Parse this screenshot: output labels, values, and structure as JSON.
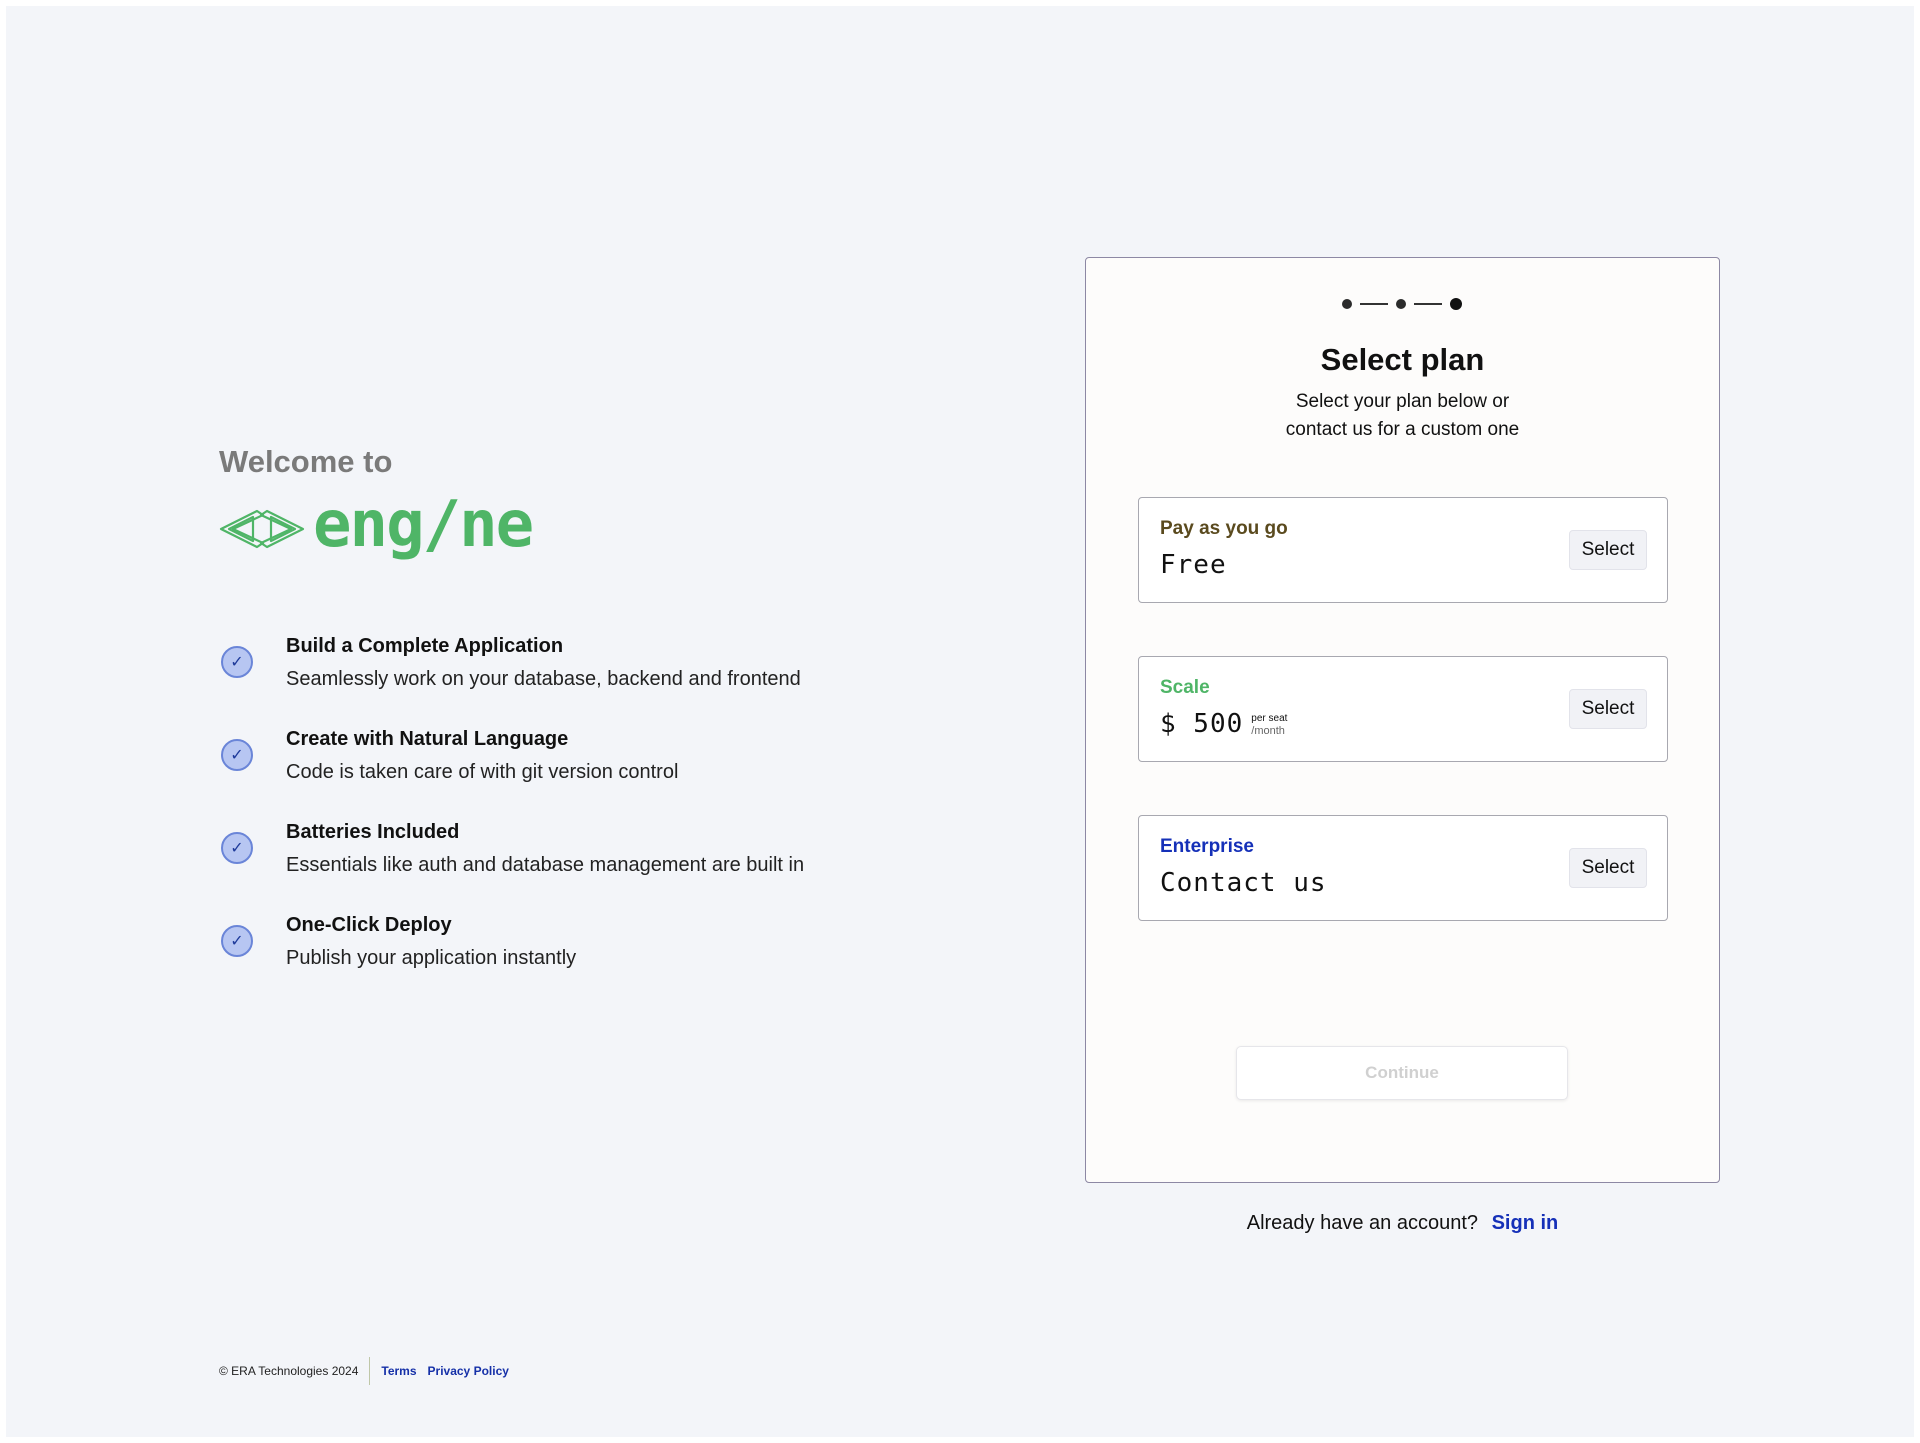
{
  "welcome": {
    "heading": "Welcome to",
    "logo_text": "eng/ne",
    "logo_icon": "code-brackets-icon"
  },
  "features": [
    {
      "title": "Build a Complete Application",
      "desc": "Seamlessly work on your database, backend and frontend"
    },
    {
      "title": "Create with Natural Language",
      "desc": "Code is taken care of with git version control"
    },
    {
      "title": "Batteries Included",
      "desc": "Essentials like auth and database management are built in"
    },
    {
      "title": "One-Click Deploy",
      "desc": "Publish your application instantly"
    }
  ],
  "footer": {
    "copyright": "© ERA Technologies 2024",
    "terms": "Terms",
    "privacy": "Privacy Policy"
  },
  "card": {
    "title": "Select plan",
    "subtitle_line1": "Select your plan below  or",
    "subtitle_line2": "contact us for a custom one",
    "steps_total": 3,
    "steps_current": 3,
    "plans": [
      {
        "name": "Pay as you go",
        "name_color": "#5a4a1e",
        "price": "Free",
        "select_label": "Select"
      },
      {
        "name": "Scale",
        "name_color": "#4fb567",
        "price": "$ 500",
        "per_seat": "per seat",
        "per_month": "/month",
        "select_label": "Select"
      },
      {
        "name": "Enterprise",
        "name_color": "#1530b8",
        "price": "Contact us",
        "select_label": "Select"
      }
    ],
    "continue_label": "Continue"
  },
  "signin": {
    "prompt": "Already have an account?",
    "link": "Sign in"
  },
  "colors": {
    "brand_green": "#4fb567",
    "link_blue": "#1530b8",
    "check_fill": "#b7c6f2"
  }
}
